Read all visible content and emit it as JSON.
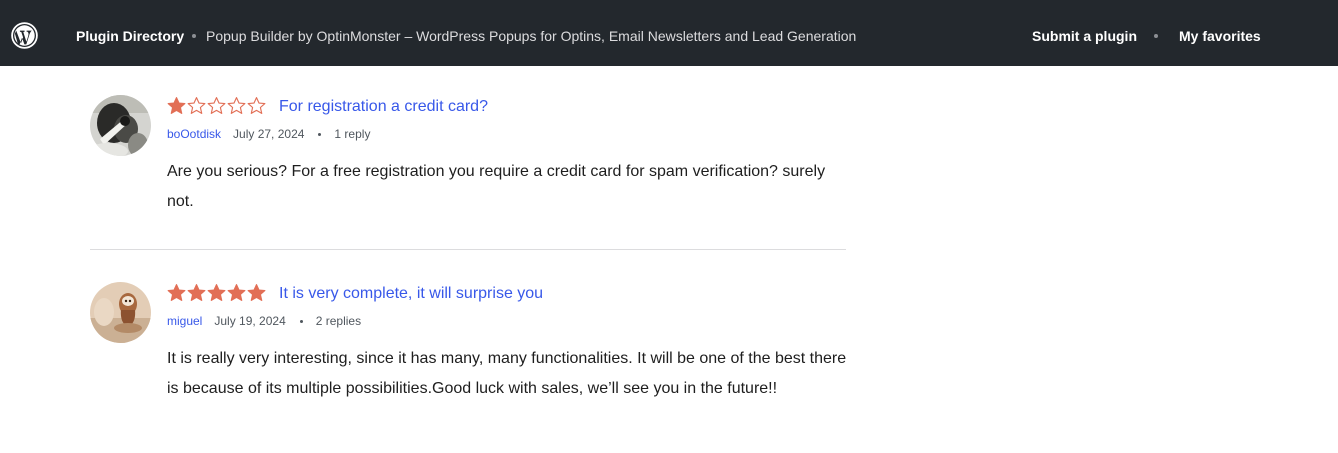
{
  "header": {
    "logo_icon": "wordpress-icon",
    "plugin_directory": "Plugin Directory",
    "plugin_name": "Popup Builder by OptinMonster – WordPress Popups for Optins, Email Newsletters and Lead Generation",
    "submit_plugin": "Submit a plugin",
    "my_favorites": "My favorites"
  },
  "reviews": [
    {
      "rating": 1,
      "max_rating": 5,
      "title": "For registration a credit card?",
      "author": "boOotdisk",
      "date": "July 27, 2024",
      "replies": "1 reply",
      "body": "Are you serious? For a free registration you require a credit card for spam verification? surely not."
    },
    {
      "rating": 5,
      "max_rating": 5,
      "title": "It is very complete, it will surprise you",
      "author": "miguel",
      "date": "July 19, 2024",
      "replies": "2 replies",
      "body": "It is really very interesting, since it has many, many functionalities. It will be one of the best there is because of its multiple possibilities.Good luck with sales, we’ll see you in the future!!"
    }
  ],
  "colors": {
    "topbar": "#23282d",
    "star": "#e26f56",
    "link": "#3858e9"
  }
}
